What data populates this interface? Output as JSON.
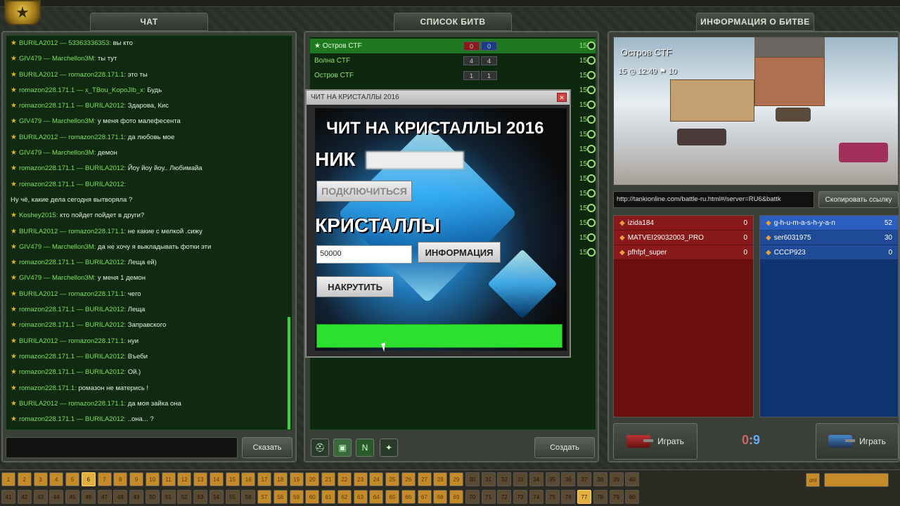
{
  "tabs": {
    "chat": "ЧАТ",
    "battles": "СПИСОК БИТВ",
    "info": "ИНФОРМАЦИЯ О БИТВЕ"
  },
  "chat": {
    "lines": [
      {
        "from": "BURILA2012 —",
        "to": "53363336353:",
        "msg": "вы кто"
      },
      {
        "from": "GIV479 —",
        "to": "Marchellon3M:",
        "msg": "ты тут"
      },
      {
        "from": "BURILA2012 —",
        "to": "romazon228.171.1:",
        "msg": "это ты"
      },
      {
        "from": "romazon228.171.1 —",
        "to": "x_TBou_KopoJIb_x:",
        "msg": "Будь"
      },
      {
        "from": "romazon228.171.1 —",
        "to": "BURILA2012:",
        "msg": "Здарова, Кис"
      },
      {
        "from": "GIV479 —",
        "to": "Marchellon3M:",
        "msg": "у меня фото малефесента"
      },
      {
        "from": "BURILA2012 —",
        "to": "romazon228.171.1:",
        "msg": "да любовь мое"
      },
      {
        "from": "GIV479 —",
        "to": "Marchellon3M:",
        "msg": "демон"
      },
      {
        "from": "romazon228.171.1 —",
        "to": "BURILA2012:",
        "msg": "Йоу йоу йоу.. Любимайа"
      },
      {
        "from": "romazon228.171.1 —",
        "to": "BURILA2012:",
        "msg": ""
      },
      {
        "from": "",
        "to": "",
        "msg": "Ну чё, какие дела сегодня вытворяла ?"
      },
      {
        "from": "Koshey2015:",
        "to": "",
        "msg": "кто пойдет пойдет в други?"
      },
      {
        "from": "BURILA2012 —",
        "to": "romazon228.171.1:",
        "msg": "не какие с мелкой .сижу"
      },
      {
        "from": "GIV479 —",
        "to": "Marchellon3M:",
        "msg": "да не хочу я выкладывать фотки эти"
      },
      {
        "from": "romazon228.171.1 —",
        "to": "BURILA2012:",
        "msg": "Леща ей)"
      },
      {
        "from": "GIV479 —",
        "to": "Marchellon3M:",
        "msg": "у меня 1 демон"
      },
      {
        "from": "BURILA2012 —",
        "to": "romazon228.171.1:",
        "msg": "чего"
      },
      {
        "from": "romazon228.171.1 —",
        "to": "BURILA2012:",
        "msg": "Леща"
      },
      {
        "from": "romazon228.171.1 —",
        "to": "BURILA2012:",
        "msg": "Заправского"
      },
      {
        "from": "BURILA2012 —",
        "to": "romazon228.171.1:",
        "msg": "нуи"
      },
      {
        "from": "romazon228.171.1 —",
        "to": "BURILA2012:",
        "msg": "Въеби"
      },
      {
        "from": "romazon228.171.1 —",
        "to": "BURILA2012:",
        "msg": "Ой.)"
      },
      {
        "from": "romazon228.171.1:",
        "to": "",
        "msg": "ромазон не матерись !"
      },
      {
        "from": "BURILA2012 —",
        "to": "romazon228.171.1:",
        "msg": "да моя зайка она"
      },
      {
        "from": "romazon228.171.1 —",
        "to": "BURILA2012:",
        "msg": "..она... ?"
      }
    ],
    "send_label": "Сказать"
  },
  "battles": {
    "rows": [
      {
        "name": "Остров CTF",
        "red": "0",
        "blue": "0",
        "max": "15"
      },
      {
        "name": "Волна CTF",
        "red": "4",
        "blue": "4",
        "max": "15"
      },
      {
        "name": "Остров CTF",
        "red": "1",
        "blue": "1",
        "max": "15"
      }
    ],
    "extra_max": [
      "15",
      "15",
      "15",
      "15",
      "15",
      "15",
      "15",
      "15",
      "15",
      "15",
      "15",
      "15"
    ],
    "create_label": "Создать"
  },
  "cheat": {
    "window_title": "ЧИТ НА КРИСТАЛЛЫ 2016",
    "heading": "ЧИТ НА КРИСТАЛЛЫ 2016",
    "nick_label": "НИК",
    "connect_label": "ПОДКЛЮЧИТЬСЯ",
    "crystals_label": "КРИСТАЛЛЫ",
    "amount_value": "50000",
    "info_label": "ИНФОРМАЦИЯ",
    "boost_label": "НАКРУТИТЬ",
    "progress": 1.0
  },
  "info": {
    "map_title": "Остров CTF",
    "limit_players": "15",
    "time": "12:49",
    "score_limit": "10",
    "url": "http://tankionline.com/battle-ru.html#/server=RU6&battk",
    "copy_label": "Скопировать ссылку",
    "red_team": [
      {
        "name": "izida184",
        "score": "0"
      },
      {
        "name": "MATVEI29032003_PRO",
        "score": "0"
      },
      {
        "name": "pfhfpf_super",
        "score": "0"
      }
    ],
    "blue_team": [
      {
        "name": "g-h-u-m-a-s-h-y-a-n",
        "score": "52"
      },
      {
        "name": "ser6031975",
        "score": "30"
      },
      {
        "name": "CCCP923",
        "score": "0"
      }
    ],
    "play_label": "Играть",
    "score_red": "0",
    "score_blue": "9",
    "score_sep": ":"
  },
  "numbers": {
    "row1": [
      "1",
      "2",
      "3",
      "4",
      "5",
      "6",
      "7",
      "8",
      "9",
      "10",
      "11",
      "12",
      "13",
      "14",
      "15",
      "16",
      "17",
      "18",
      "19",
      "20",
      "21",
      "22",
      "23",
      "24",
      "25",
      "26",
      "27",
      "28",
      "29",
      "30",
      "31",
      "32",
      "33",
      "34",
      "35",
      "36",
      "37",
      "38",
      "39",
      "40"
    ],
    "row2": [
      "41",
      "42",
      "43",
      "44",
      "45",
      "46",
      "47",
      "48",
      "49",
      "50",
      "51",
      "52",
      "53",
      "54",
      "55",
      "56",
      "57",
      "58",
      "59",
      "60",
      "61",
      "62",
      "63",
      "64",
      "65",
      "66",
      "67",
      "68",
      "69",
      "70",
      "71",
      "72",
      "73",
      "74",
      "75",
      "76",
      "77",
      "78",
      "79",
      "80"
    ],
    "right_btn": "onl"
  }
}
